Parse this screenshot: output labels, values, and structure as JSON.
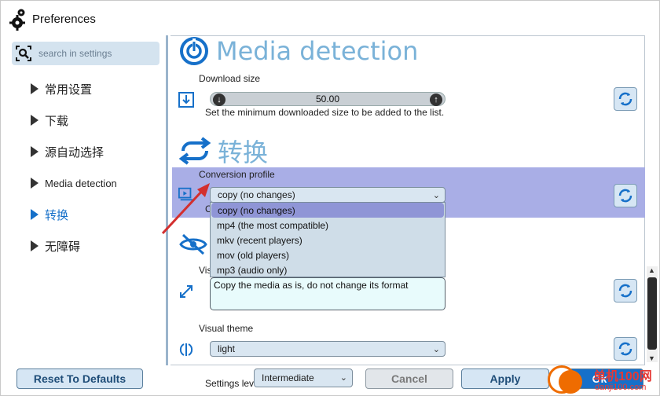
{
  "window": {
    "title": "Preferences"
  },
  "search": {
    "placeholder": "search in settings"
  },
  "sidebar": {
    "items": [
      {
        "label": "常用设置"
      },
      {
        "label": "下载"
      },
      {
        "label": "源自动选择"
      },
      {
        "label": "Media detection"
      },
      {
        "label": "转换",
        "active": true
      },
      {
        "label": "无障碍"
      }
    ]
  },
  "main": {
    "media_detection": {
      "heading": "Media detection",
      "download_size_label": "Download size",
      "download_size_value": "50.00",
      "download_size_help": "Set the minimum downloaded size to be added to the list."
    },
    "conversion": {
      "heading": "转换",
      "profile_label": "Conversion profile",
      "profile_selected": "copy (no changes)",
      "options": [
        "copy (no changes)",
        "mp4 (the most compatible)",
        "mkv (recent players)",
        "mov (old players)",
        "mp3 (audio only)"
      ],
      "hidden_c": "C",
      "vis_label": "Vis",
      "description": "Copy the media as is, do not change its format"
    },
    "visual_theme": {
      "label": "Visual theme",
      "value": "light"
    }
  },
  "footer": {
    "reset_label": "Reset To Defaults",
    "settings_level_label": "Settings level",
    "settings_level_value": "Intermediate",
    "cancel_label": "Cancel",
    "apply_label": "Apply",
    "ok_label": "Ok"
  },
  "watermark": {
    "line1": "单机100网",
    "line2": "danji100.com"
  },
  "colors": {
    "accent": "#1670c9",
    "heading": "#7ab2d8",
    "highlight_row": "#a9aee6",
    "selected_option": "#8f95d6",
    "arrow": "#d32f2f"
  }
}
